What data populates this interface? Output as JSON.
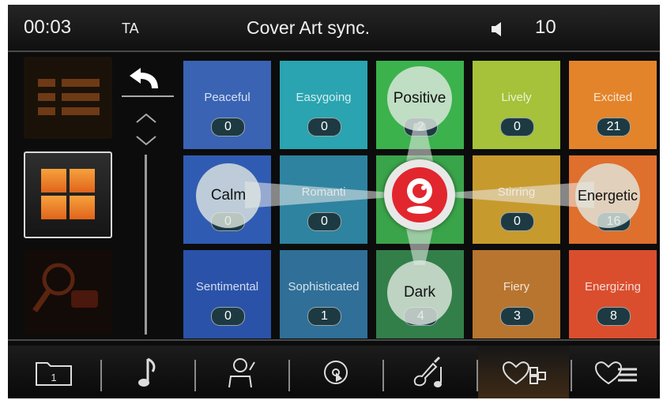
{
  "status_bar": {
    "time": "00:03",
    "ta": "TA",
    "title": "Cover Art sync.",
    "volume": "10",
    "volume_icon": "speaker-icon"
  },
  "side_panel": {
    "list_view_icon": "list-view-icon",
    "grid_view_icon": "grid-view-icon",
    "search_icon": "search-icon",
    "back_icon": "back-arrow-icon"
  },
  "mood_grid": {
    "tiles": [
      {
        "label": "Peaceful",
        "count": "0",
        "color": "#3a63b4"
      },
      {
        "label": "Easygoing",
        "count": "0",
        "color": "#2aa4b0"
      },
      {
        "label": "",
        "count": "2",
        "color": "#3bb24c"
      },
      {
        "label": "Lively",
        "count": "0",
        "color": "#a5c23a"
      },
      {
        "label": "Excited",
        "count": "21",
        "color": "#e3842a"
      },
      {
        "label": "",
        "count": "0",
        "color": "#2f5cb2"
      },
      {
        "label": "Romanti",
        "count": "0",
        "color": "#2e83a0"
      },
      {
        "label": "",
        "count": "",
        "color": "#3aa44a"
      },
      {
        "label": "Stirring",
        "count": "0",
        "color": "#c79a2e"
      },
      {
        "label": "",
        "count": "16",
        "color": "#df6f2c"
      },
      {
        "label": "Sentimental",
        "count": "0",
        "color": "#2a52a8"
      },
      {
        "label": "Sophisticated",
        "count": "1",
        "color": "#2f6f98"
      },
      {
        "label": "",
        "count": "4",
        "color": "#327f49"
      },
      {
        "label": "Fiery",
        "count": "3",
        "color": "#b87530"
      },
      {
        "label": "Energizing",
        "count": "8",
        "color": "#da4e2e"
      }
    ],
    "bubbles": {
      "positive": "Positive",
      "calm": "Calm",
      "energetic": "Energetic",
      "dark": "Dark"
    },
    "center_icon": "mood-selector-icon"
  },
  "bottom_nav": [
    {
      "icon": "folder-icon",
      "label": "1"
    },
    {
      "icon": "music-note-icon"
    },
    {
      "icon": "artist-icon"
    },
    {
      "icon": "disc-icon"
    },
    {
      "icon": "genre-guitar-icon"
    },
    {
      "icon": "mood-icon"
    },
    {
      "icon": "playlist-icon"
    }
  ]
}
